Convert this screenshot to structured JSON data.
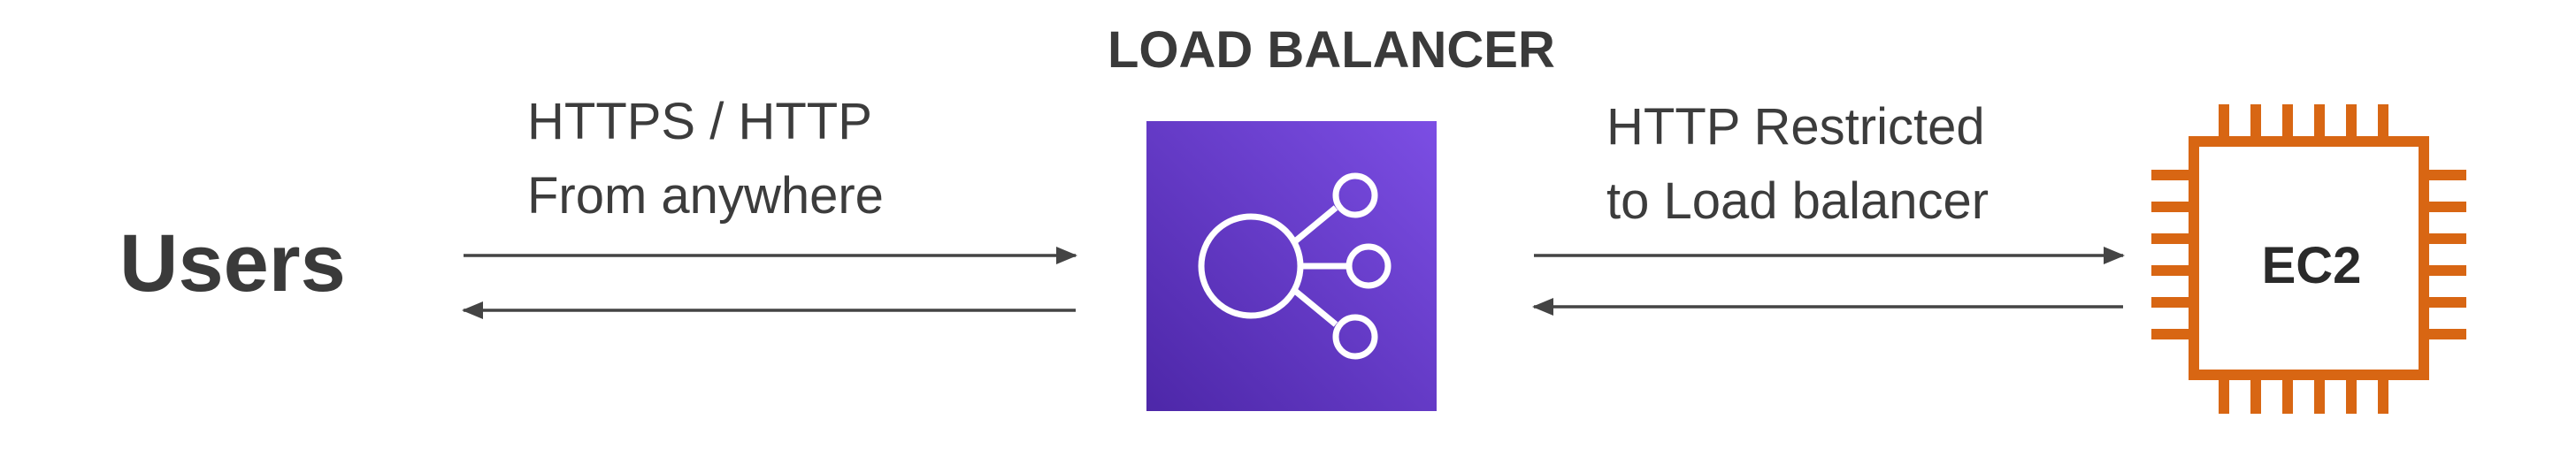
{
  "title": "LOAD BALANCER",
  "nodes": {
    "users": "Users",
    "load_balancer": "",
    "ec2": "EC2"
  },
  "edges": {
    "users_to_lb": {
      "line1": "HTTPS / HTTP",
      "line2": "From anywhere"
    },
    "lb_to_ec2": {
      "line1": "HTTP Restricted",
      "line2": "to Load balancer"
    }
  },
  "colors": {
    "load_balancer_gradient_start": "#4d27a8",
    "load_balancer_gradient_end": "#7c4ee4",
    "ec2_orange": "#d86613",
    "arrow": "#444444",
    "text": "#3c3c3c"
  },
  "icons": {
    "load_balancer": "elastic-load-balancing-icon",
    "ec2": "ec2-chip-icon"
  }
}
